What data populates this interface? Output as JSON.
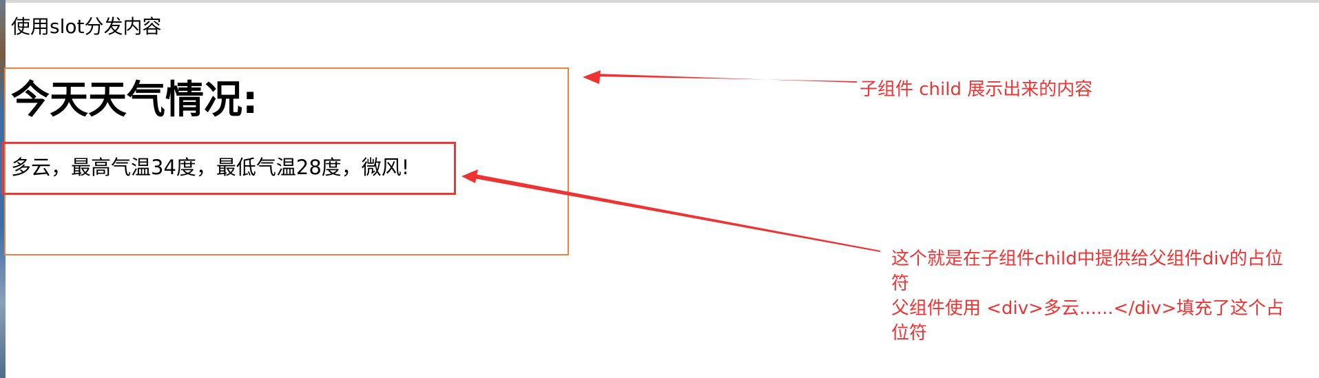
{
  "page": {
    "heading": "使用slot分发内容"
  },
  "child_component": {
    "title": "今天天气情况:",
    "slot_content": "多云，最高气温34度，最低气温28度，微风!"
  },
  "annotations": {
    "child_label": "子组件 child 展示出来的内容",
    "slot_label_line1": "这个就是在子组件child中提供给父组件div的占位",
    "slot_label_line2": "符",
    "slot_label_line3": "父组件使用 <div>多云......</div>填充了这个占",
    "slot_label_line4": "位符"
  },
  "colors": {
    "child_box_border": "#f08040",
    "slot_box_border": "#e83838",
    "annotation_text": "#ee3333",
    "arrow": "#ee3333"
  }
}
